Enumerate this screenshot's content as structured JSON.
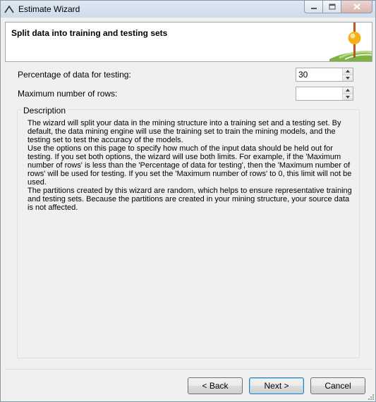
{
  "window": {
    "title": "Estimate Wizard"
  },
  "header": {
    "title": "Split data into training and testing sets"
  },
  "fields": {
    "testing_percentage": {
      "label": "Percentage of data for testing:",
      "value": "30"
    },
    "max_rows": {
      "label": "Maximum number of rows:",
      "value": ""
    }
  },
  "description": {
    "title": "Description",
    "paragraphs": [
      "The wizard will split your data in the mining structure into a training set and a testing set. By default, the data mining engine will use the training set to train the mining models, and the testing set to test the accuracy of the models.",
      "Use the options on this page to specify how much of the input data should be held out for testing. If you set both options, the wizard will use both limits. For example, if the 'Maximum number of rows' is less than the 'Percentage of data for testing', then the 'Maximum number of rows' will be used for testing. If you set the 'Maximum number of rows' to 0, this limit will not be used.",
      "The partitions created by this wizard are random, which helps to ensure representative training and testing sets. Because the partitions are created in your mining structure, your source data is not affected."
    ]
  },
  "buttons": {
    "back": "< Back",
    "next": "Next >",
    "cancel": "Cancel"
  }
}
